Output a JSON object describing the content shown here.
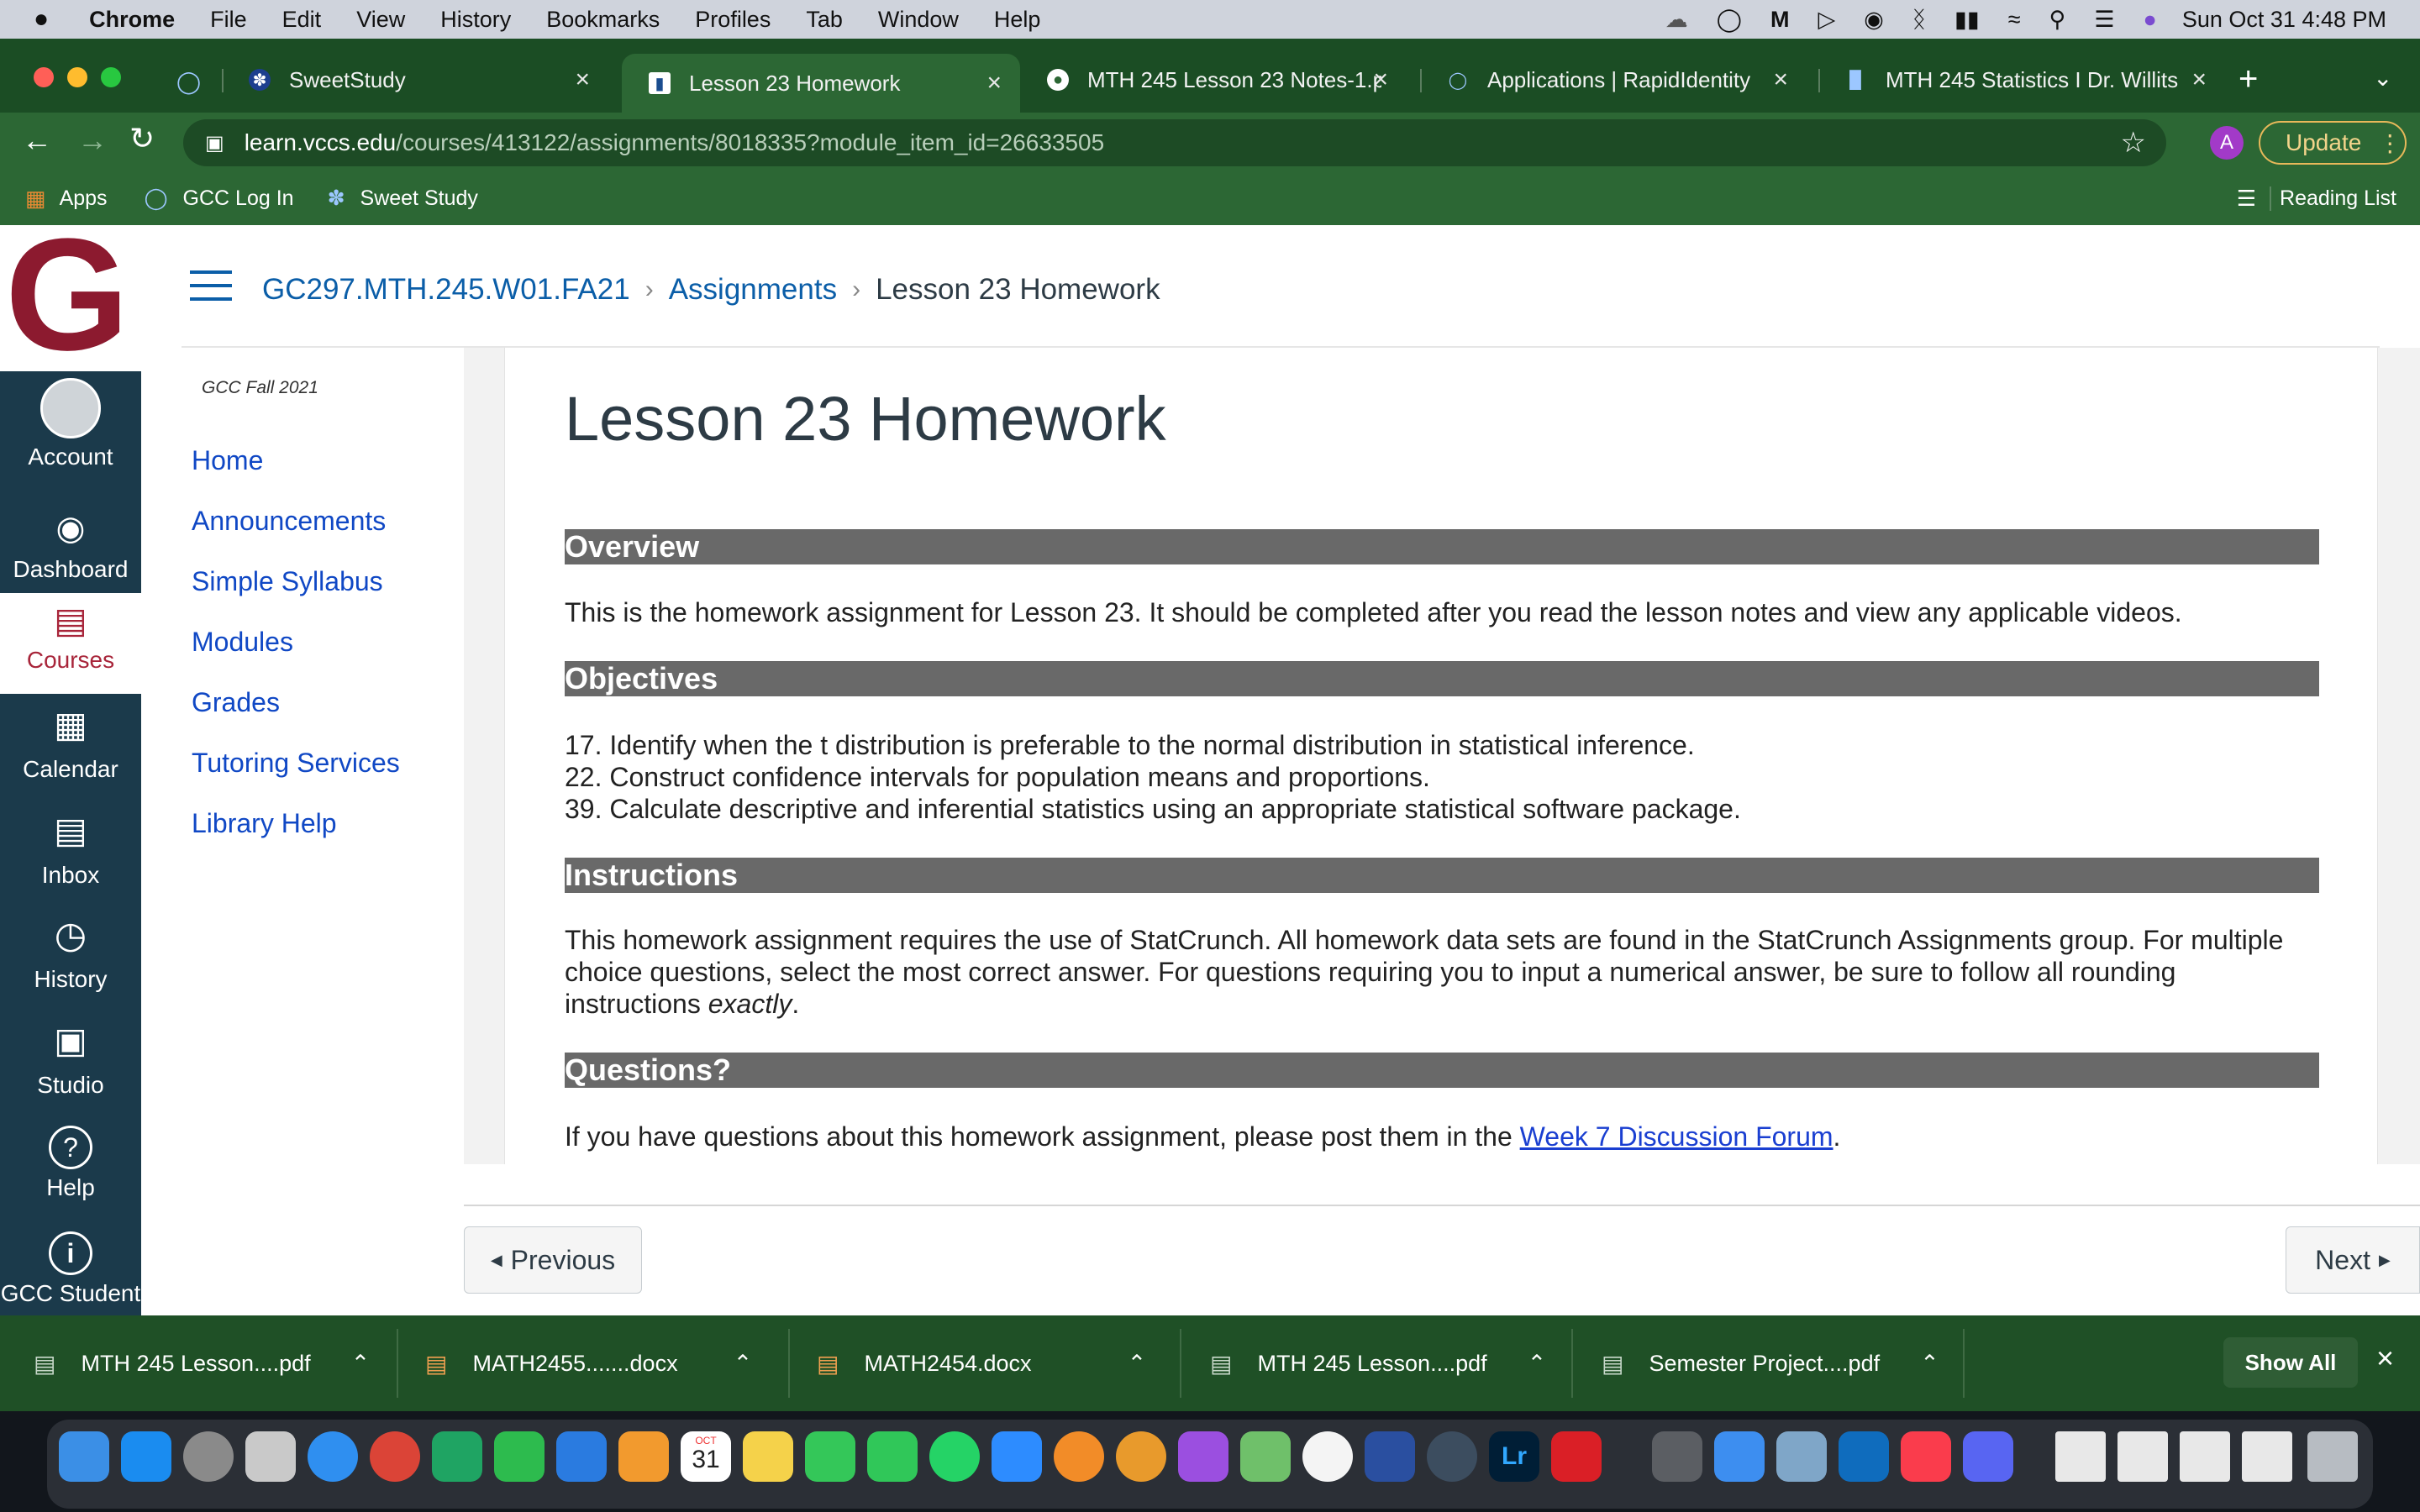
{
  "menubar": {
    "app": "Chrome",
    "items": [
      "File",
      "Edit",
      "View",
      "History",
      "Bookmarks",
      "Profiles",
      "Tab",
      "Window",
      "Help"
    ],
    "datetime": "Sun Oct 31  4:48 PM"
  },
  "tabs": [
    {
      "title": "SweetStudy",
      "active": false
    },
    {
      "title": "Lesson 23 Homework",
      "active": true
    },
    {
      "title": "MTH 245 Lesson 23 Notes-1.p",
      "active": false
    },
    {
      "title": "Applications | RapidIdentity",
      "active": false
    },
    {
      "title": "MTH 245 Statistics I Dr. Willits",
      "active": false
    }
  ],
  "address": {
    "domain": "learn.vccs.edu",
    "path": "/courses/413122/assignments/8018335?module_item_id=26633505"
  },
  "toolbar": {
    "update_label": "Update",
    "profile_initial": "A"
  },
  "bookmarks": {
    "items": [
      "Apps",
      "GCC Log In",
      "Sweet Study"
    ],
    "reading_list": "Reading List"
  },
  "global_nav": [
    {
      "label": "Account",
      "icon": "account-icon"
    },
    {
      "label": "Dashboard",
      "icon": "dashboard-icon"
    },
    {
      "label": "Courses",
      "icon": "courses-icon",
      "active": true
    },
    {
      "label": "Calendar",
      "icon": "calendar-icon"
    },
    {
      "label": "Inbox",
      "icon": "inbox-icon"
    },
    {
      "label": "History",
      "icon": "history-icon"
    },
    {
      "label": "Studio",
      "icon": "studio-icon"
    },
    {
      "label": "Help",
      "icon": "help-icon"
    },
    {
      "label": "GCC Student",
      "icon": "info-icon"
    }
  ],
  "breadcrumb": {
    "course": "GC297.MTH.245.W01.FA21",
    "section": "Assignments",
    "current": "Lesson 23 Homework"
  },
  "course_nav": {
    "term": "GCC Fall 2021",
    "links": [
      "Home",
      "Announcements",
      "Simple Syllabus",
      "Modules",
      "Grades",
      "Tutoring Services",
      "Library Help"
    ]
  },
  "assignment": {
    "title": "Lesson 23 Homework",
    "overview_heading": "Overview",
    "overview_text": "This is the homework assignment for Lesson 23. It should be completed after you read the lesson notes and view any applicable videos.",
    "objectives_heading": "Objectives",
    "objectives": [
      "17. Identify when the t distribution is preferable to the normal distribution in statistical inference.",
      "22. Construct confidence intervals for population means and proportions.",
      "39. Calculate descriptive and inferential statistics using an appropriate statistical software package."
    ],
    "instructions_heading": "Instructions",
    "instructions_text": "This homework assignment requires the use of StatCrunch. All homework data sets are found in the StatCrunch Assignments group. For multiple choice questions, select the most correct answer. For questions requiring you to input a numerical answer, be sure to follow all rounding instructions",
    "instructions_emph": "exactly",
    "instructions_end": ".",
    "questions_heading": "Questions?",
    "questions_text": "If you have questions about this homework assignment, please post them in the",
    "questions_link": "Week 7 Discussion Forum",
    "questions_end": "."
  },
  "pager": {
    "previous": "Previous",
    "next": "Next"
  },
  "downloads": {
    "items": [
      "MTH 245 Lesson....pdf",
      "MATH2455.......docx",
      "MATH2454.docx",
      "MTH 245 Lesson....pdf",
      "Semester Project....pdf"
    ],
    "show_all": "Show All"
  },
  "dock": {
    "calendar_month": "OCT",
    "calendar_day": "31"
  }
}
